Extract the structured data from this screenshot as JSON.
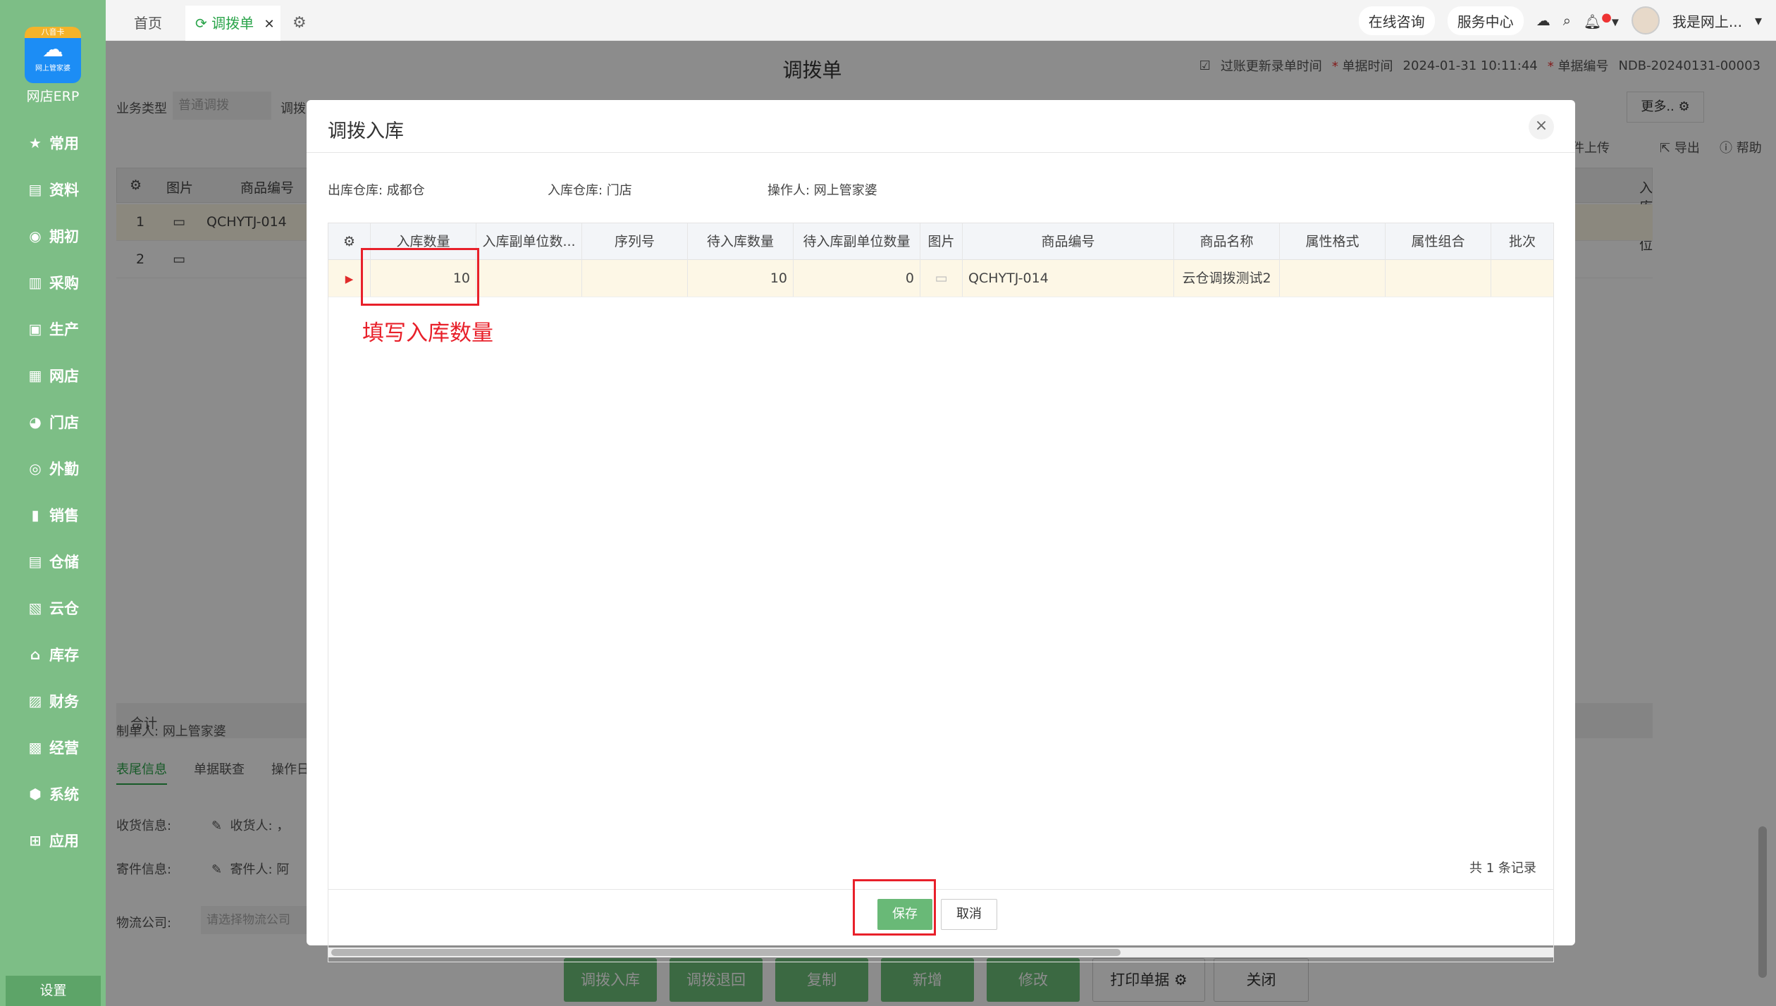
{
  "app": {
    "logo_top": "八音卡",
    "logo_sub": "网上管家婆",
    "brand": "网店ERP",
    "settings": "设置"
  },
  "sidebar": {
    "items": [
      {
        "label": "常用",
        "icon": "star-icon"
      },
      {
        "label": "资料",
        "icon": "document-icon"
      },
      {
        "label": "期初",
        "icon": "target-icon"
      },
      {
        "label": "采购",
        "icon": "purchase-icon"
      },
      {
        "label": "生产",
        "icon": "production-icon"
      },
      {
        "label": "网店",
        "icon": "shop-icon"
      },
      {
        "label": "门店",
        "icon": "store-icon"
      },
      {
        "label": "外勤",
        "icon": "field-icon"
      },
      {
        "label": "销售",
        "icon": "sales-icon"
      },
      {
        "label": "仓储",
        "icon": "warehouse-icon"
      },
      {
        "label": "云仓",
        "icon": "cloud-warehouse-icon"
      },
      {
        "label": "库存",
        "icon": "inventory-icon"
      },
      {
        "label": "财务",
        "icon": "finance-icon"
      },
      {
        "label": "经营",
        "icon": "business-icon"
      },
      {
        "label": "系统",
        "icon": "system-icon"
      },
      {
        "label": "应用",
        "icon": "apps-icon"
      }
    ]
  },
  "topbar": {
    "tab_home": "首页",
    "tab_active": "调拨单",
    "consult": "在线咨询",
    "service": "服务中心",
    "user": "我是网上..."
  },
  "doc": {
    "title": "调拨单",
    "posting_time_label": "过账更新录单时间",
    "bill_time_label": "单据时间",
    "bill_time": "2024-01-31 10:11:44",
    "bill_no_label": "单据编号",
    "bill_no": "NDB-20240131-00003",
    "biz_type_label": "业务类型",
    "biz_type_value": "普通调拨",
    "biz_type_next": "调拨",
    "more": "更多..",
    "upload": "件上传",
    "export": "导出",
    "help": "帮助",
    "grid_headers": {
      "image": "图片",
      "code": "商品编号",
      "location": "入库货位"
    },
    "rows": [
      {
        "no": "1",
        "code": "QCHYTJ-014"
      },
      {
        "no": "2",
        "code": ""
      }
    ],
    "sum_label": "合计",
    "maker_label": "制单人:",
    "maker": "网上管家婆",
    "bottom_tabs": [
      "表尾信息",
      "单据联查",
      "操作日"
    ],
    "receive_label": "收货信息:",
    "receiver_label": "收货人: ，",
    "send_label": "寄件信息:",
    "sender_label": "寄件人: 阿",
    "logistics_label": "物流公司:",
    "logistics_placeholder": "请选择物流公司",
    "buttons": {
      "transfer_in": "调拨入库",
      "transfer_back": "调拨退回",
      "copy": "复制",
      "add": "新增",
      "edit": "修改",
      "print": "打印单据",
      "close": "关闭"
    }
  },
  "modal": {
    "title": "调拨入库",
    "out_wh": "出库仓库: 成都仓",
    "in_wh": "入库仓库: 门店",
    "operator": "操作人: 网上管家婆",
    "columns": [
      "入库数量",
      "入库副单位数...",
      "序列号",
      "待入库数量",
      "待入库副单位数量",
      "图片",
      "商品编号",
      "商品名称",
      "属性格式",
      "属性组合",
      "批次"
    ],
    "row": {
      "qty": "10",
      "sub_qty": "",
      "serial": "",
      "pending_qty": "10",
      "pending_sub_qty": "0",
      "code": "QCHYTJ-014",
      "name": "云仓调拨测试2",
      "attr_format": "",
      "attr_combo": "",
      "batch": ""
    },
    "annotation": "填写入库数量",
    "count": "共 1 条记录",
    "save": "保存",
    "cancel": "取消"
  },
  "colors": {
    "sidebar": "#7dbe86",
    "accent": "#2aa44a",
    "highlight": "#e8202a",
    "row_selected": "#fdf7e6"
  }
}
